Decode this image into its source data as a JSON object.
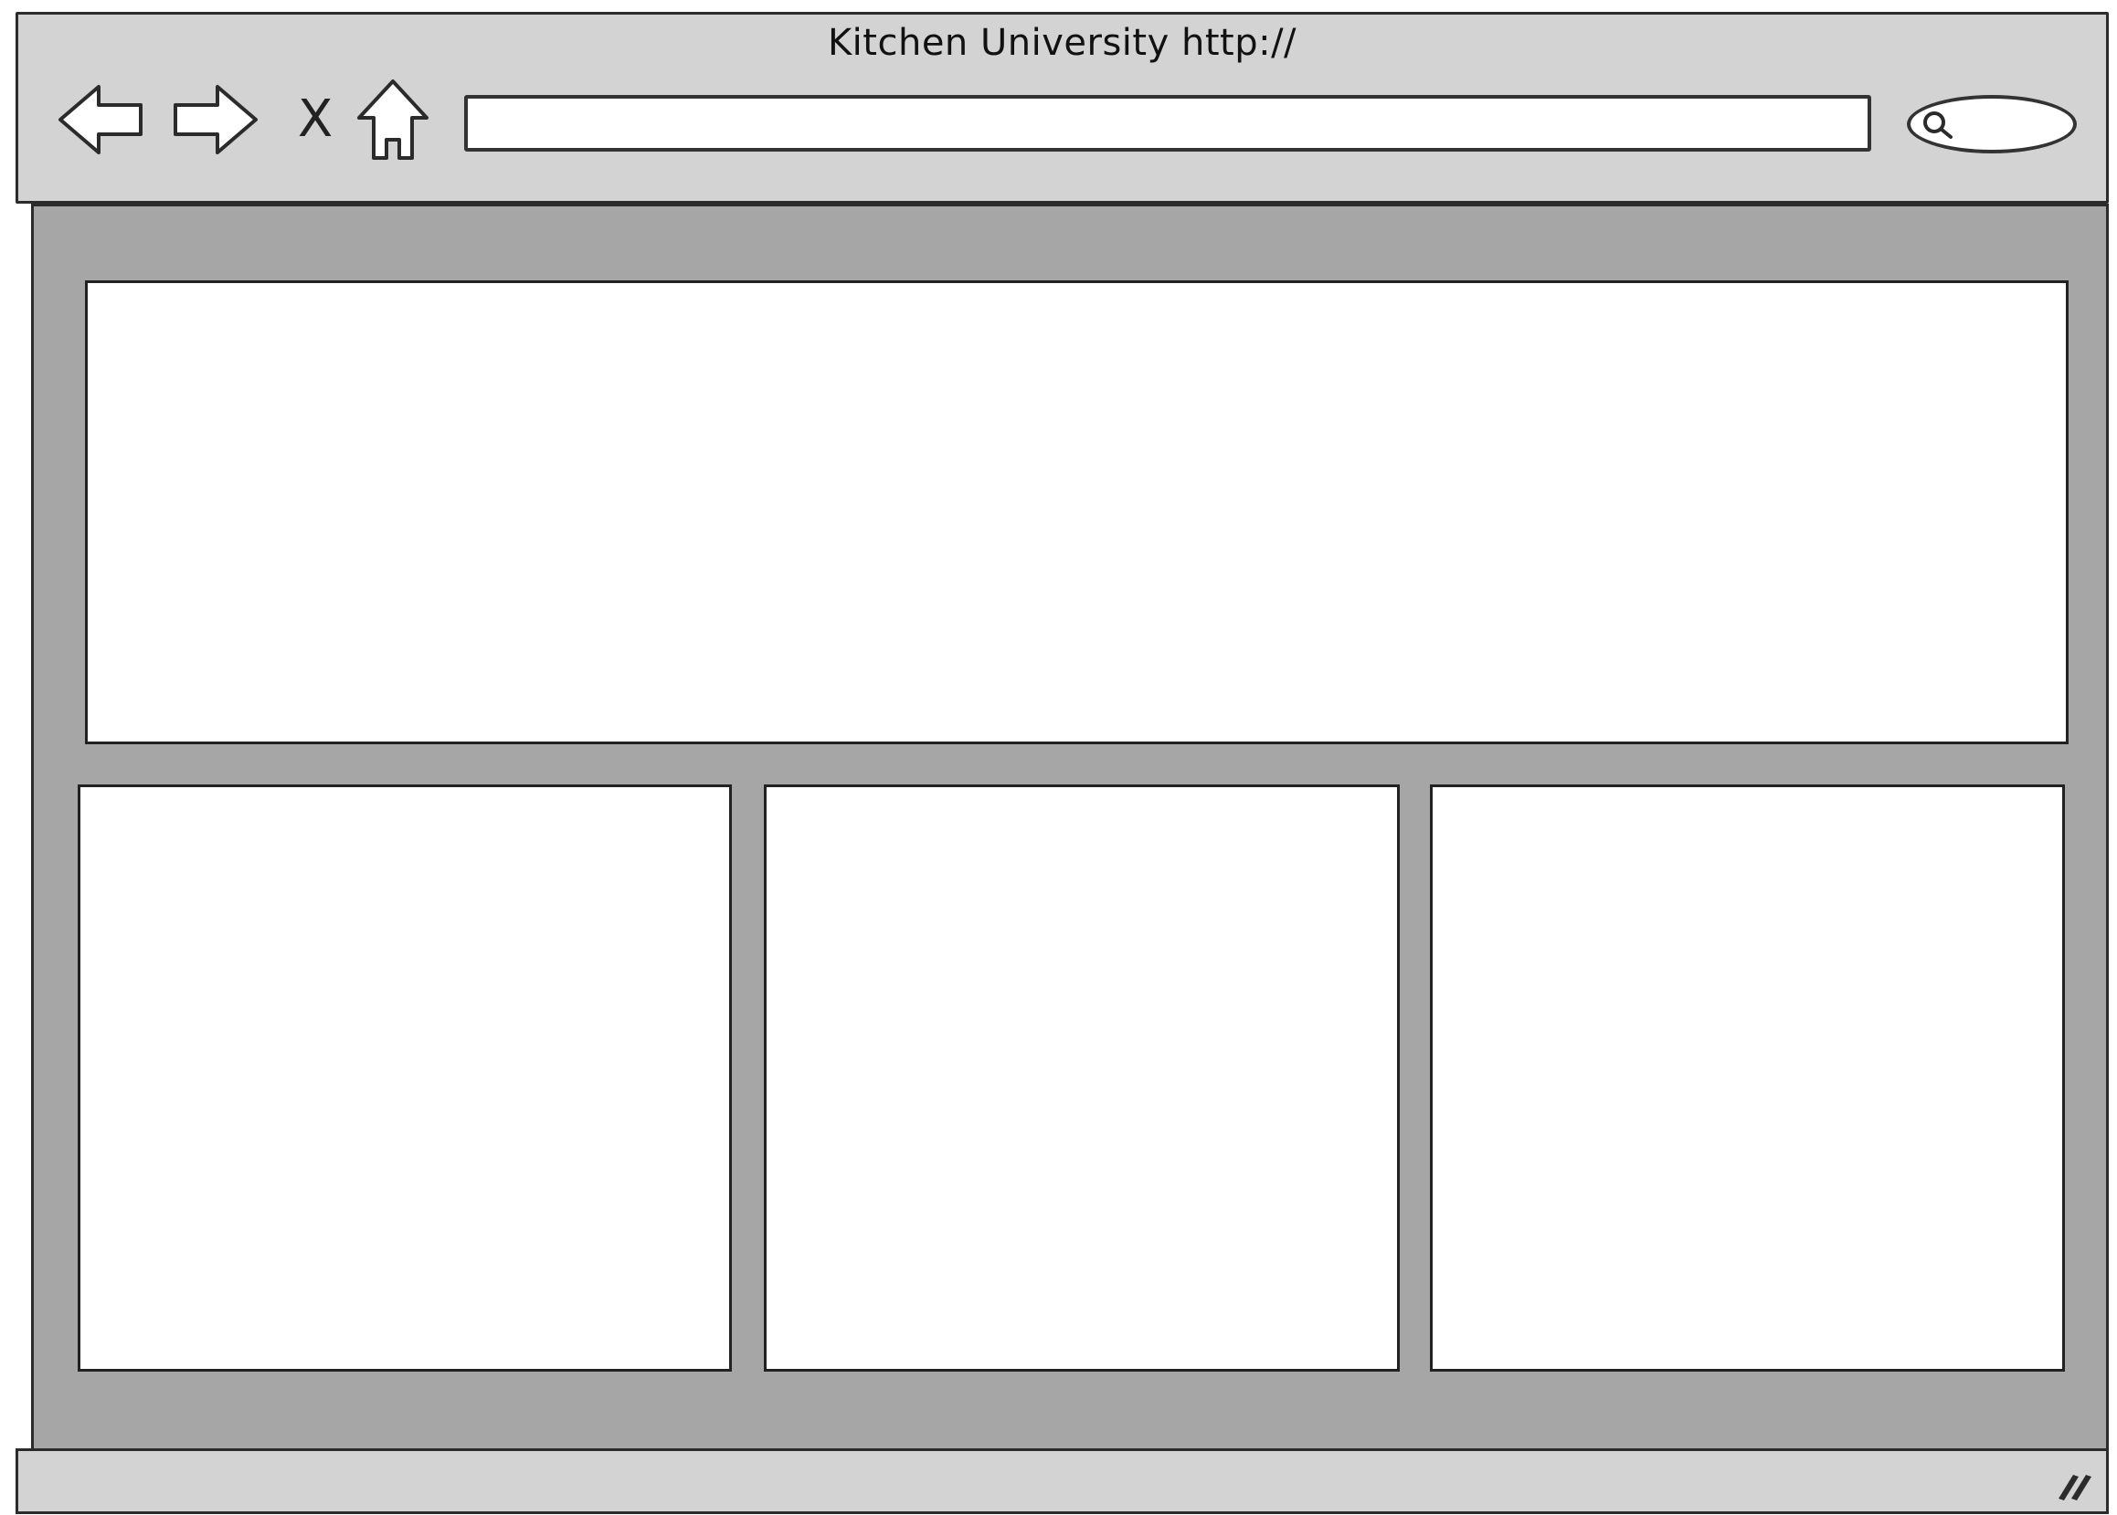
{
  "window": {
    "title": "Kitchen University http://"
  },
  "toolbar": {
    "back_icon": "back-arrow-icon",
    "forward_icon": "forward-arrow-icon",
    "stop_label": "X",
    "home_icon": "home-icon",
    "address_value": "",
    "search_icon": "search-icon"
  },
  "colors": {
    "chrome": "#d3d3d3",
    "viewport": "#a6a6a6",
    "panel": "#ffffff",
    "stroke": "#2b2b2b"
  }
}
